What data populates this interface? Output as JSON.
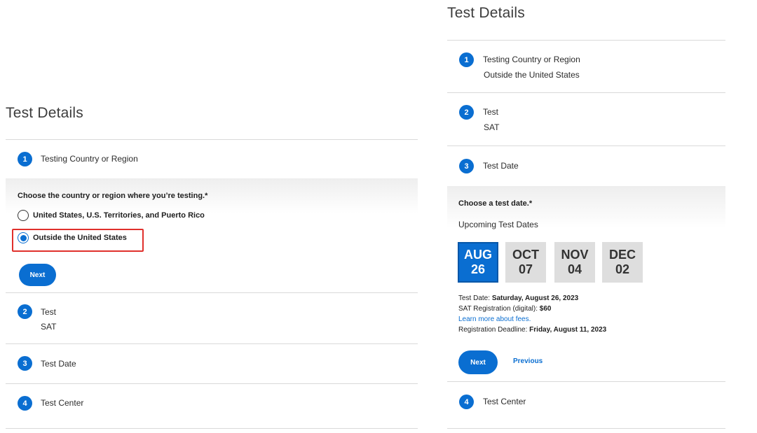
{
  "left": {
    "title": "Test Details",
    "steps": [
      {
        "num": "1",
        "label": "Testing Country or Region"
      },
      {
        "num": "2",
        "label": "Test",
        "value": "SAT"
      },
      {
        "num": "3",
        "label": "Test Date"
      },
      {
        "num": "4",
        "label": "Test Center"
      }
    ],
    "question": "Choose the country or region where you’re testing.*",
    "options": [
      {
        "label": "United States, U.S. Territories, and Puerto Rico",
        "checked": false
      },
      {
        "label": "Outside the United States",
        "checked": true
      }
    ],
    "next_label": "Next"
  },
  "right": {
    "title": "Test Details",
    "steps": [
      {
        "num": "1",
        "label": "Testing Country or Region",
        "value": "Outside the United States"
      },
      {
        "num": "2",
        "label": "Test",
        "value": "SAT"
      },
      {
        "num": "3",
        "label": "Test Date"
      },
      {
        "num": "4",
        "label": "Test Center"
      }
    ],
    "question": "Choose a test date.*",
    "subhead": "Upcoming Test Dates",
    "dates": [
      {
        "month": "AUG",
        "day": "26",
        "selected": true
      },
      {
        "month": "OCT",
        "day": "07",
        "selected": false
      },
      {
        "month": "NOV",
        "day": "04",
        "selected": false
      },
      {
        "month": "DEC",
        "day": "02",
        "selected": false
      }
    ],
    "info": {
      "test_date_label": "Test Date: ",
      "test_date_value": "Saturday, August 26, 2023",
      "registration_label": "SAT Registration (digital): ",
      "registration_value": "$60",
      "fees_link": "Learn more about fees.",
      "deadline_label": "Registration Deadline: ",
      "deadline_value": "Friday, August 11, 2023"
    },
    "next_label": "Next",
    "previous_label": "Previous"
  },
  "colors": {
    "accent": "#0a6ed1",
    "highlight": "#e0302c"
  }
}
